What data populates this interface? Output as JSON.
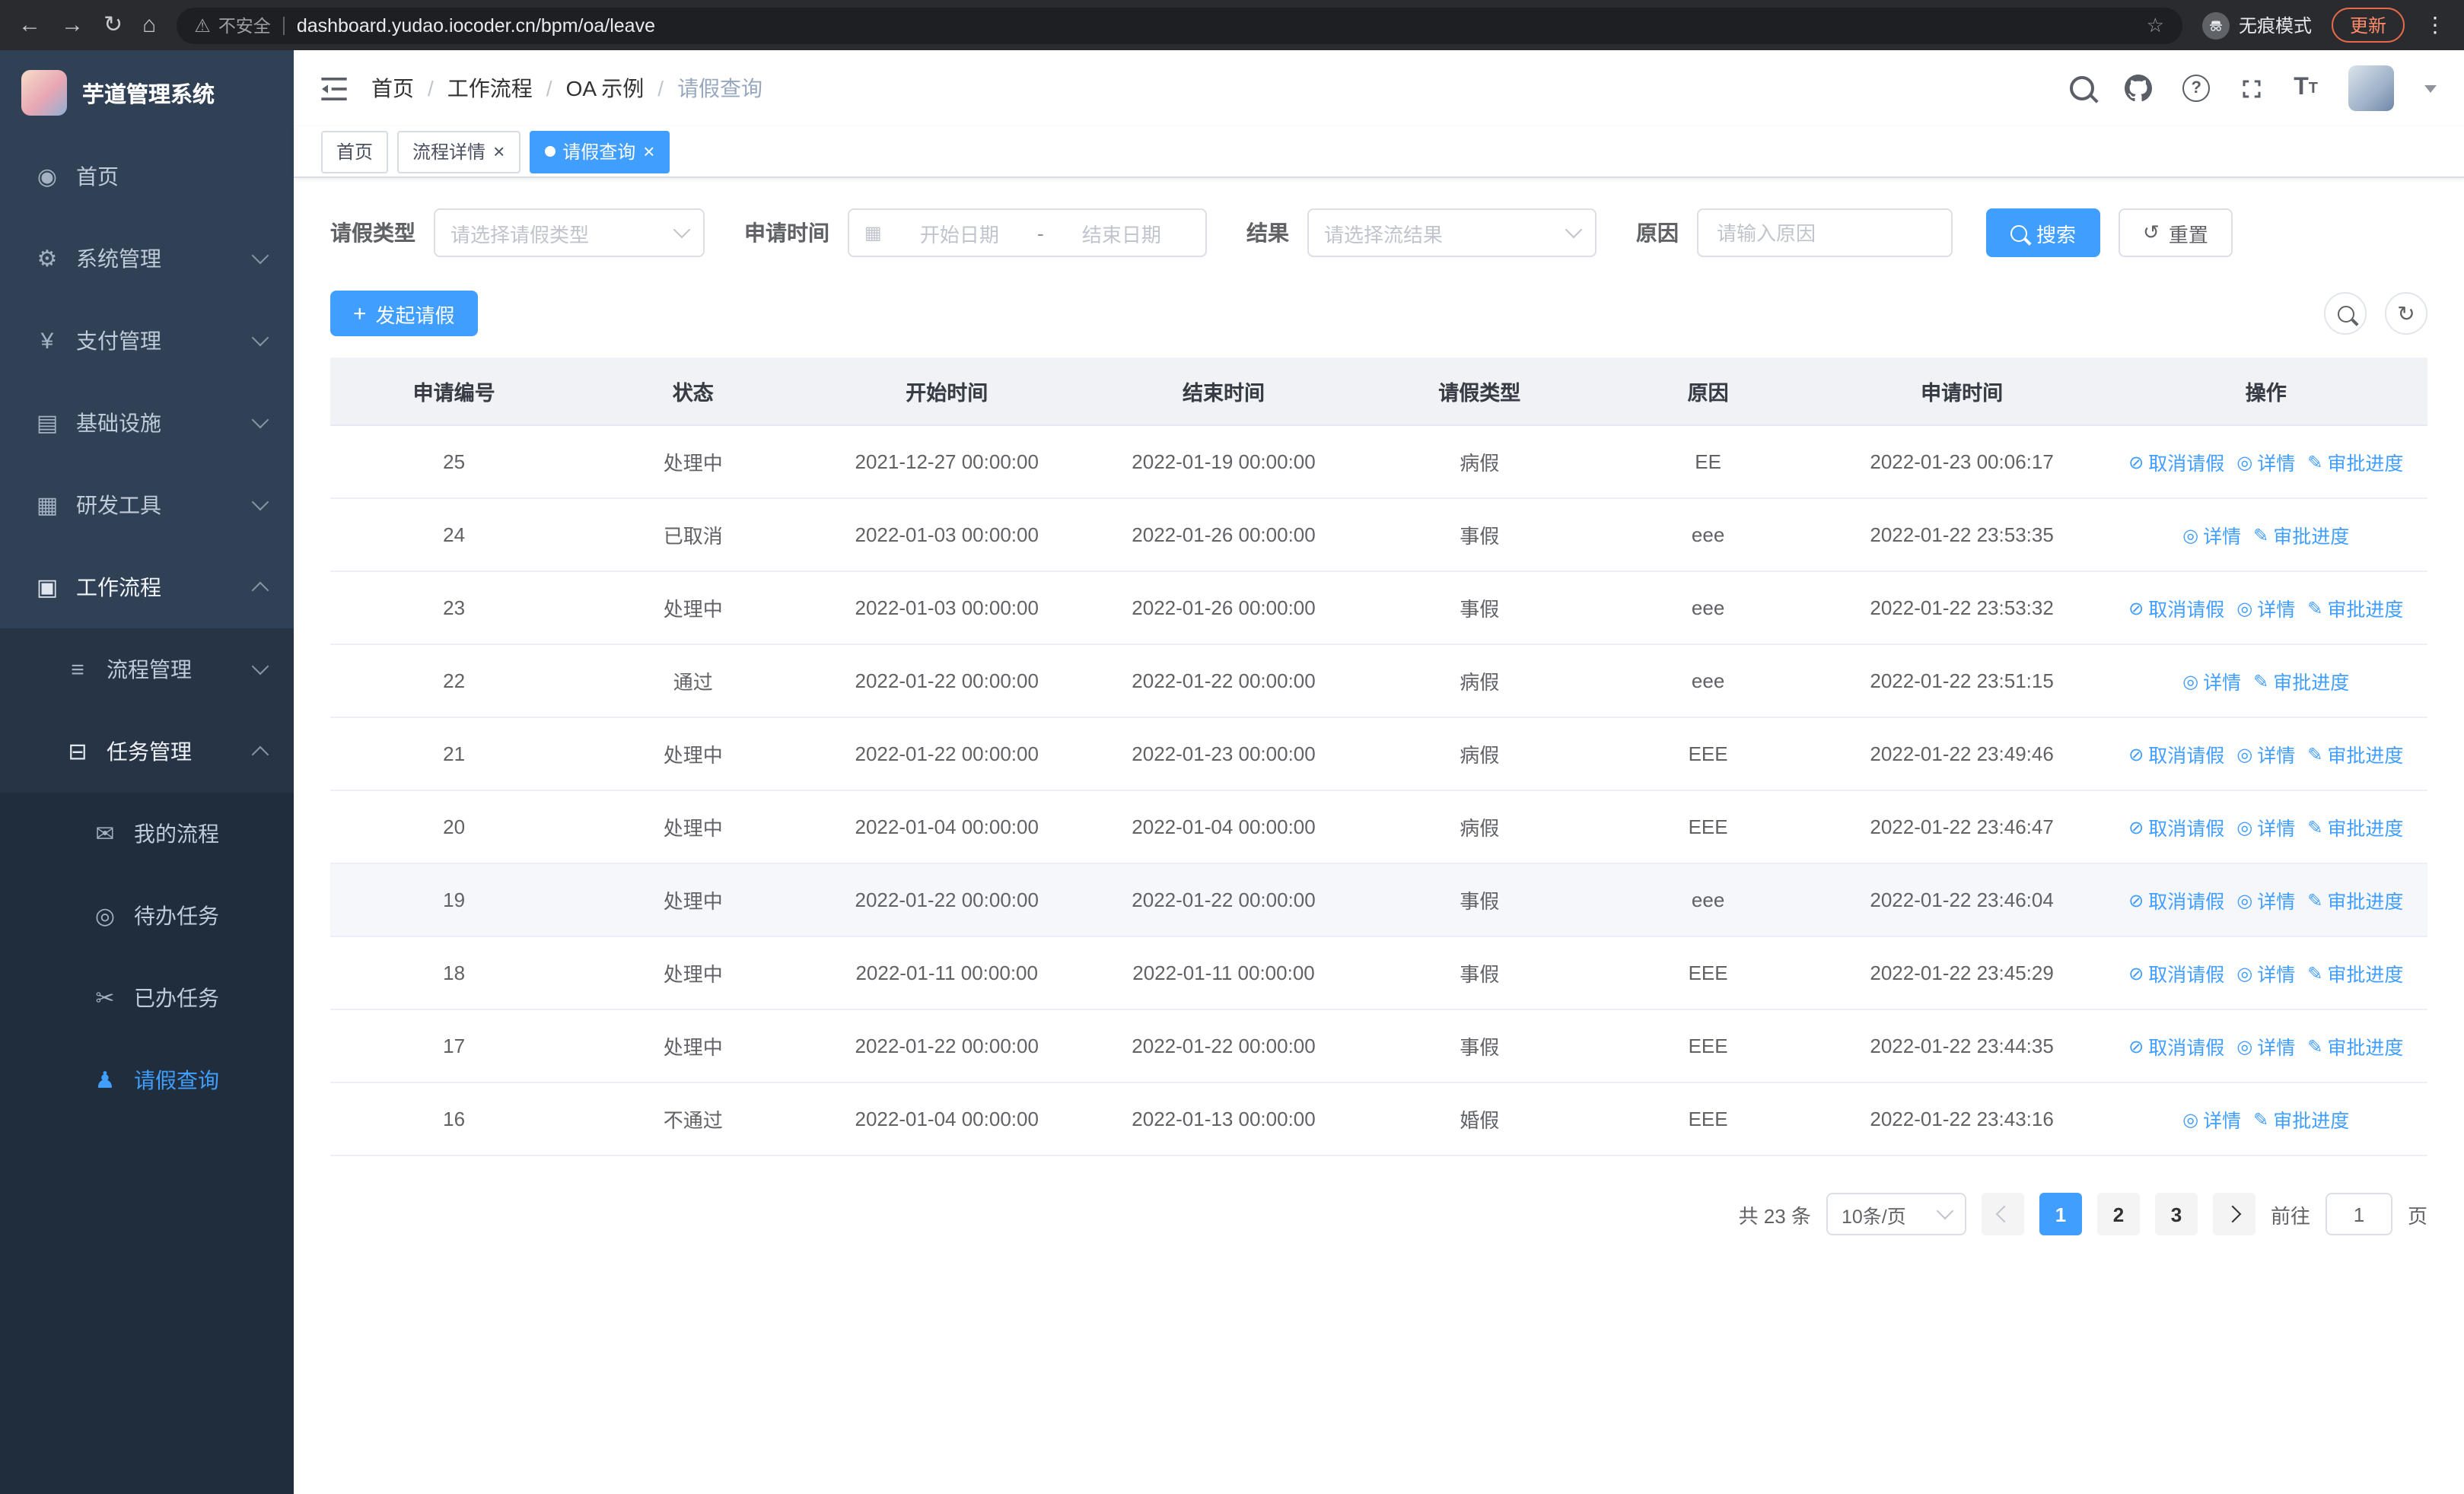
{
  "colors": {
    "primary": "#409eff",
    "sidebar_bg": "#304156",
    "sidebar_submenu_bg": "#263445",
    "sidebar_leaf_bg": "#1f2d3d"
  },
  "browser": {
    "security_label": "不安全",
    "url": "dashboard.yudao.iocoder.cn/bpm/oa/leave",
    "incognito_label": "无痕模式",
    "update_label": "更新"
  },
  "sidebar": {
    "logo_title": "芋道管理系统",
    "items": [
      {
        "name": "home",
        "label": "首页",
        "icon": "dashboard-icon",
        "glyph": "◉",
        "level": 1
      },
      {
        "name": "system-mgmt",
        "label": "系统管理",
        "icon": "gear-icon",
        "glyph": "⚙",
        "level": 1,
        "chevron": "down"
      },
      {
        "name": "payment-mgmt",
        "label": "支付管理",
        "icon": "yen-icon",
        "glyph": "¥",
        "level": 1,
        "chevron": "down"
      },
      {
        "name": "infrastructure",
        "label": "基础设施",
        "icon": "infrastructure-icon",
        "glyph": "▤",
        "level": 1,
        "chevron": "down"
      },
      {
        "name": "dev-tools",
        "label": "研发工具",
        "icon": "tools-icon",
        "glyph": "▦",
        "level": 1,
        "chevron": "down"
      },
      {
        "name": "workflow",
        "label": "工作流程",
        "icon": "workflow-icon",
        "glyph": "▣",
        "level": 1,
        "chevron": "up",
        "bright": true
      },
      {
        "name": "process-mgmt",
        "label": "流程管理",
        "icon": "process-list-icon",
        "glyph": "≡",
        "level": 2,
        "chevron": "down"
      },
      {
        "name": "task-mgmt",
        "label": "任务管理",
        "icon": "task-icon",
        "glyph": "⊟",
        "level": 2,
        "chevron": "up",
        "bright": true
      },
      {
        "name": "my-process",
        "label": "我的流程",
        "icon": "message-icon",
        "glyph": "✉",
        "level": 3
      },
      {
        "name": "todo-tasks",
        "label": "待办任务",
        "icon": "eye-icon",
        "glyph": "◎",
        "level": 3
      },
      {
        "name": "done-tasks",
        "label": "已办任务",
        "icon": "scissors-icon",
        "glyph": "✂",
        "level": 3
      },
      {
        "name": "leave-query",
        "label": "请假查询",
        "icon": "user-icon",
        "glyph": "♟",
        "level": 3,
        "active": true
      }
    ]
  },
  "header": {
    "breadcrumb": [
      "首页",
      "工作流程",
      "OA 示例",
      "请假查询"
    ],
    "icons": [
      "search-icon",
      "github-icon",
      "help-icon",
      "fullscreen-icon",
      "font-size-icon",
      "avatar",
      "chevron-down-icon"
    ]
  },
  "tabs": [
    {
      "name": "home",
      "label": "首页",
      "closable": false,
      "active": false
    },
    {
      "name": "process-detail",
      "label": "流程详情",
      "closable": true,
      "active": false
    },
    {
      "name": "leave-query",
      "label": "请假查询",
      "closable": true,
      "active": true
    }
  ],
  "filters": {
    "leave_type_label": "请假类型",
    "leave_type_placeholder": "请选择请假类型",
    "apply_time_label": "申请时间",
    "start_date_placeholder": "开始日期",
    "range_separator": "-",
    "end_date_placeholder": "结束日期",
    "result_label": "结果",
    "result_placeholder": "请选择流结果",
    "reason_label": "原因",
    "reason_placeholder": "请输入原因",
    "search_label": "搜索",
    "reset_label": "重置"
  },
  "toolbar": {
    "create_label": "发起请假"
  },
  "table": {
    "columns": [
      "申请编号",
      "状态",
      "开始时间",
      "结束时间",
      "请假类型",
      "原因",
      "申请时间",
      "操作"
    ],
    "action_defs": {
      "cancel": {
        "label": "取消请假",
        "icon": "cancel-icon",
        "glyph": "⊘"
      },
      "detail": {
        "label": "详情",
        "icon": "eye-icon",
        "glyph": "◎"
      },
      "progress": {
        "label": "审批进度",
        "icon": "edit-icon",
        "glyph": "✎"
      }
    },
    "rows": [
      {
        "id": "25",
        "status": "处理中",
        "start": "2021-12-27 00:00:00",
        "end": "2022-01-19 00:00:00",
        "type": "病假",
        "reason": "EE",
        "applied": "2022-01-23 00:06:17",
        "actions": [
          "cancel",
          "detail",
          "progress"
        ]
      },
      {
        "id": "24",
        "status": "已取消",
        "start": "2022-01-03 00:00:00",
        "end": "2022-01-26 00:00:00",
        "type": "事假",
        "reason": "eee",
        "applied": "2022-01-22 23:53:35",
        "actions": [
          "detail",
          "progress"
        ]
      },
      {
        "id": "23",
        "status": "处理中",
        "start": "2022-01-03 00:00:00",
        "end": "2022-01-26 00:00:00",
        "type": "事假",
        "reason": "eee",
        "applied": "2022-01-22 23:53:32",
        "actions": [
          "cancel",
          "detail",
          "progress"
        ]
      },
      {
        "id": "22",
        "status": "通过",
        "start": "2022-01-22 00:00:00",
        "end": "2022-01-22 00:00:00",
        "type": "病假",
        "reason": "eee",
        "applied": "2022-01-22 23:51:15",
        "actions": [
          "detail",
          "progress"
        ]
      },
      {
        "id": "21",
        "status": "处理中",
        "start": "2022-01-22 00:00:00",
        "end": "2022-01-23 00:00:00",
        "type": "病假",
        "reason": "EEE",
        "applied": "2022-01-22 23:49:46",
        "actions": [
          "cancel",
          "detail",
          "progress"
        ]
      },
      {
        "id": "20",
        "status": "处理中",
        "start": "2022-01-04 00:00:00",
        "end": "2022-01-04 00:00:00",
        "type": "病假",
        "reason": "EEE",
        "applied": "2022-01-22 23:46:47",
        "actions": [
          "cancel",
          "detail",
          "progress"
        ]
      },
      {
        "id": "19",
        "status": "处理中",
        "start": "2022-01-22 00:00:00",
        "end": "2022-01-22 00:00:00",
        "type": "事假",
        "reason": "eee",
        "applied": "2022-01-22 23:46:04",
        "actions": [
          "cancel",
          "detail",
          "progress"
        ],
        "highlighted": true
      },
      {
        "id": "18",
        "status": "处理中",
        "start": "2022-01-11 00:00:00",
        "end": "2022-01-11 00:00:00",
        "type": "事假",
        "reason": "EEE",
        "applied": "2022-01-22 23:45:29",
        "actions": [
          "cancel",
          "detail",
          "progress"
        ]
      },
      {
        "id": "17",
        "status": "处理中",
        "start": "2022-01-22 00:00:00",
        "end": "2022-01-22 00:00:00",
        "type": "事假",
        "reason": "EEE",
        "applied": "2022-01-22 23:44:35",
        "actions": [
          "cancel",
          "detail",
          "progress"
        ]
      },
      {
        "id": "16",
        "status": "不通过",
        "start": "2022-01-04 00:00:00",
        "end": "2022-01-13 00:00:00",
        "type": "婚假",
        "reason": "EEE",
        "applied": "2022-01-22 23:43:16",
        "actions": [
          "detail",
          "progress"
        ]
      }
    ]
  },
  "pagination": {
    "total_text": "共 23 条",
    "page_size": "10条/页",
    "pages": [
      "1",
      "2",
      "3"
    ],
    "active_page": "1",
    "goto_label": "前往",
    "goto_value": "1",
    "goto_suffix": "页"
  }
}
